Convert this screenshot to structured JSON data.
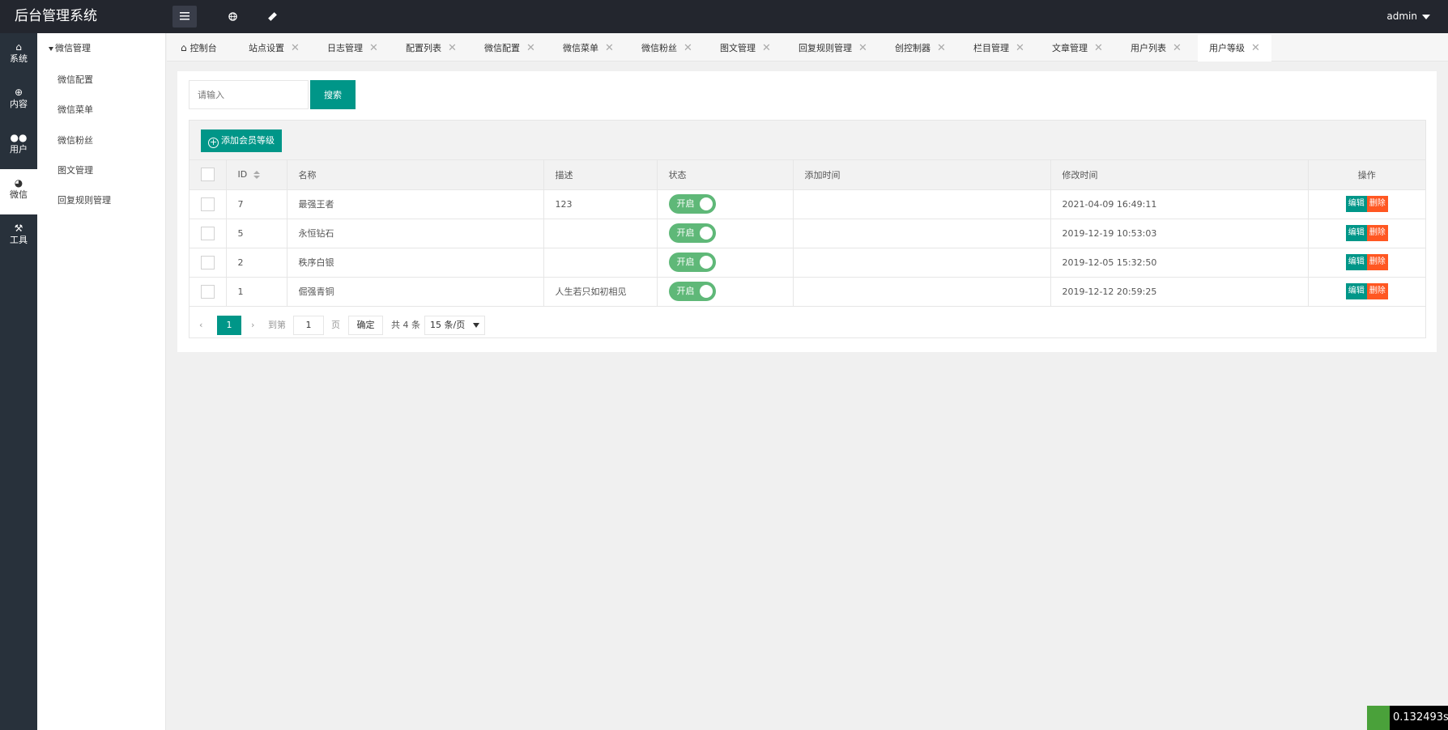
{
  "app": {
    "title": "后台管理系统",
    "user": "admin"
  },
  "iconbar": [
    {
      "label": "系统",
      "icon": "home-icon"
    },
    {
      "label": "内容",
      "icon": "plus-circle-icon"
    },
    {
      "label": "用户",
      "icon": "users-icon"
    },
    {
      "label": "微信",
      "icon": "wechat-icon",
      "active": true
    },
    {
      "label": "工具",
      "icon": "hammer-icon"
    }
  ],
  "submenu": {
    "head": "微信管理",
    "items": [
      "微信配置",
      "微信菜单",
      "微信粉丝",
      "图文管理",
      "回复规则管理"
    ]
  },
  "tabs": [
    {
      "label": "控制台",
      "closable": false
    },
    {
      "label": "站点设置"
    },
    {
      "label": "日志管理"
    },
    {
      "label": "配置列表"
    },
    {
      "label": "微信配置"
    },
    {
      "label": "微信菜单"
    },
    {
      "label": "微信粉丝"
    },
    {
      "label": "图文管理"
    },
    {
      "label": "回复规则管理"
    },
    {
      "label": "创控制器"
    },
    {
      "label": "栏目管理"
    },
    {
      "label": "文章管理"
    },
    {
      "label": "用户列表"
    },
    {
      "label": "用户等级",
      "active": true
    }
  ],
  "tab_close_glyph": "✕",
  "search": {
    "placeholder": "请输入",
    "button": "搜索"
  },
  "toolbar": {
    "add_label": "添加会员等级"
  },
  "table": {
    "headers": {
      "id": "ID",
      "name": "名称",
      "desc": "描述",
      "status": "状态",
      "added": "添加时间",
      "modified": "修改时间",
      "ops": "操作"
    },
    "rows": [
      {
        "id": "7",
        "name": "最强王者",
        "desc": "123",
        "status": "开启",
        "added": "",
        "modified": "2021-04-09 16:49:11"
      },
      {
        "id": "5",
        "name": "永恒钻石",
        "desc": "",
        "status": "开启",
        "added": "",
        "modified": "2019-12-19 10:53:03"
      },
      {
        "id": "2",
        "name": "秩序白银",
        "desc": "",
        "status": "开启",
        "added": "",
        "modified": "2019-12-05 15:32:50"
      },
      {
        "id": "1",
        "name": "倔强青铜",
        "desc": "人生若只如初相见",
        "status": "开启",
        "added": "",
        "modified": "2019-12-12 20:59:25"
      }
    ],
    "edit_label": "编辑",
    "delete_label": "删除"
  },
  "pager": {
    "current": "1",
    "goto_prefix": "到第",
    "goto_value": "1",
    "goto_suffix": "页",
    "confirm": "确定",
    "total": "共 4 条",
    "per_page": "15 条/页"
  },
  "timer_badge": "0.132493s",
  "colors": {
    "primary": "#009688",
    "danger": "#ff5722",
    "switch_on": "#5fb878",
    "header": "#23262e"
  }
}
